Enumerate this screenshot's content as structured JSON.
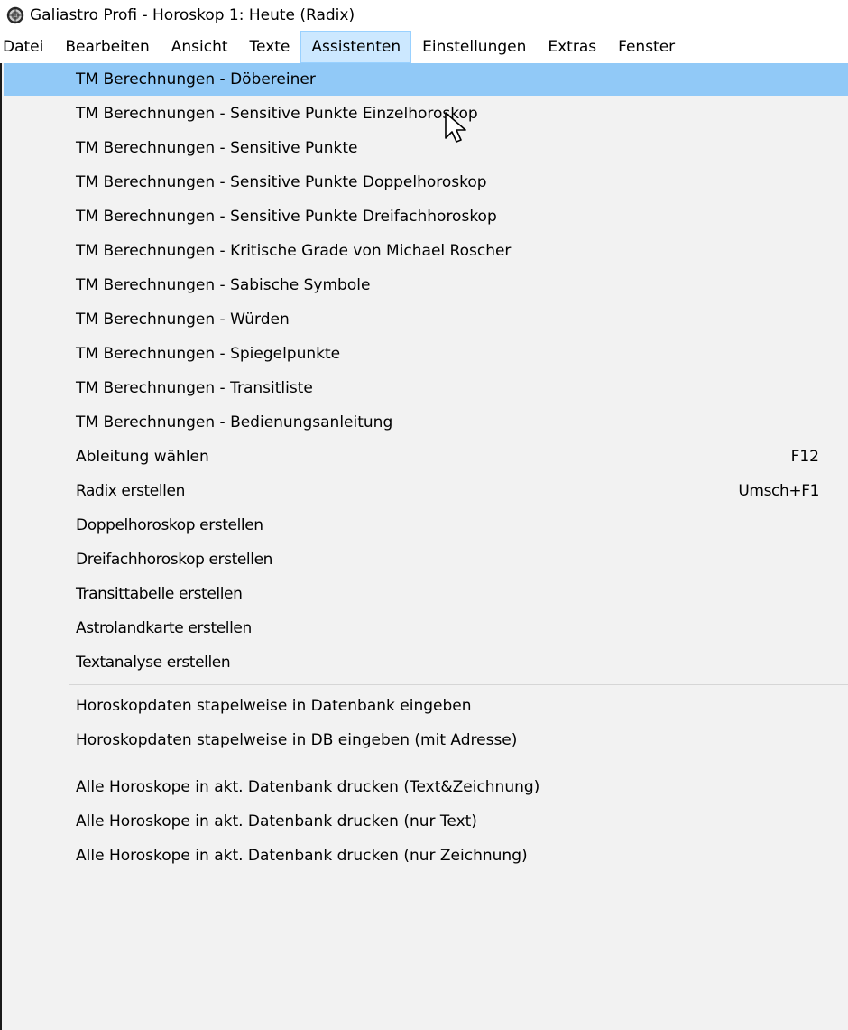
{
  "window": {
    "title": "Galiastro Profi - Horoskop 1: Heute (Radix)",
    "app_icon": "galiastro-logo-icon"
  },
  "menubar": {
    "items": [
      {
        "label": "Datei"
      },
      {
        "label": "Bearbeiten"
      },
      {
        "label": "Ansicht"
      },
      {
        "label": "Texte"
      },
      {
        "label": "Assistenten",
        "active": true
      },
      {
        "label": "Einstellungen"
      },
      {
        "label": "Extras"
      },
      {
        "label": "Fenster"
      }
    ]
  },
  "menu": {
    "highlight_color": "#91c9f7",
    "groups": [
      {
        "items": [
          {
            "label": "TM Berechnungen - Döbereiner",
            "highlighted": true
          },
          {
            "label": "TM Berechnungen - Sensitive Punkte Einzelhoroskop"
          },
          {
            "label": "TM Berechnungen - Sensitive Punkte"
          },
          {
            "label": "TM Berechnungen - Sensitive Punkte Doppelhoroskop"
          },
          {
            "label": "TM Berechnungen - Sensitive Punkte Dreifachhoroskop"
          },
          {
            "label": "TM Berechnungen - Kritische Grade von Michael Roscher"
          },
          {
            "label": "TM Berechnungen - Sabische Symbole"
          },
          {
            "label": "TM Berechnungen - Würden"
          },
          {
            "label": "TM Berechnungen - Spiegelpunkte"
          },
          {
            "label": "TM Berechnungen - Transitliste"
          },
          {
            "label": "TM Berechnungen - Bedienungsanleitung"
          },
          {
            "label": "Ableitung wählen",
            "shortcut": "F12"
          },
          {
            "label": "Radix erstellen",
            "shortcut": "Umsch+F1"
          },
          {
            "label": "Doppelhoroskop erstellen"
          },
          {
            "label": "Dreifachhoroskop erstellen"
          },
          {
            "label": "Transittabelle erstellen"
          },
          {
            "label": "Astrolandkarte erstellen"
          },
          {
            "label": "Textanalyse erstellen"
          }
        ]
      },
      {
        "items": [
          {
            "label": "Horoskopdaten stapelweise in Datenbank eingeben"
          },
          {
            "label": "Horoskopdaten stapelweise in DB eingeben (mit Adresse)"
          }
        ]
      },
      {
        "items": [
          {
            "label": "Alle Horoskope in akt. Datenbank drucken (Text&Zeichnung)"
          },
          {
            "label": "Alle Horoskope in akt. Datenbank drucken (nur Text)"
          },
          {
            "label": "Alle Horoskope in akt. Datenbank drucken (nur Zeichnung)"
          }
        ]
      }
    ]
  }
}
